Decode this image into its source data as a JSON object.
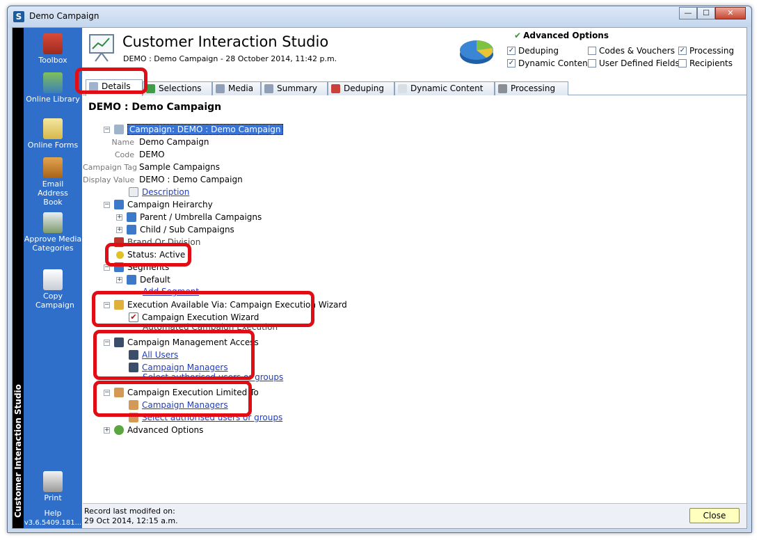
{
  "window": {
    "title": "Demo Campaign",
    "app_icon": "S"
  },
  "sidebar": {
    "vertical_label": "Customer Interaction Studio",
    "version": "v3.6.5409.181..."
  },
  "tools": [
    {
      "icon": "toolbox-icon",
      "label": "Toolbox"
    },
    {
      "icon": "online-library-icon",
      "label": "Online Library"
    },
    {
      "icon": "online-forms-icon",
      "label": "Online Forms"
    },
    {
      "icon": "email-address-book-icon",
      "label": "Email Address Book"
    },
    {
      "icon": "approve-media-icon",
      "label": "Approve Media Categories"
    },
    {
      "icon": "copy-campaign-icon",
      "label": "Copy Campaign"
    },
    {
      "icon": "print-icon",
      "label": "Print"
    },
    {
      "icon": "help-icon",
      "label": "Help"
    }
  ],
  "header": {
    "title": "Customer Interaction Studio",
    "subtitle": "DEMO : Demo Campaign - 28 October 2014, 11:42 p.m.",
    "advanced_options_title": "Advanced Options",
    "options": [
      {
        "label": "Deduping",
        "checked": true
      },
      {
        "label": "Codes & Vouchers",
        "checked": false
      },
      {
        "label": "Processing",
        "checked": true
      },
      {
        "label": "Dynamic Content",
        "checked": true
      },
      {
        "label": "User Defined Fields",
        "checked": false
      },
      {
        "label": "Recipients",
        "checked": false
      }
    ]
  },
  "tabs": [
    "Details",
    "Selections",
    "Media",
    "Summary",
    "Deduping",
    "Dynamic Content",
    "Processing"
  ],
  "content": {
    "title": "DEMO : Demo Campaign",
    "tree": {
      "campaign": "Campaign:  DEMO : Demo Campaign",
      "fields": [
        {
          "label": "Name",
          "value": "Demo Campaign"
        },
        {
          "label": "Code",
          "value": "DEMO"
        },
        {
          "label": "Campaign Tag",
          "value": "Sample Campaigns"
        },
        {
          "label": "Display Value",
          "value": "DEMO : Demo Campaign"
        }
      ],
      "description_link": "Description",
      "hierarchy": "Campaign Heirarchy",
      "parent": "Parent / Umbrella Campaigns",
      "child": "Child / Sub Campaigns",
      "brand": "Brand Or Division",
      "status": "Status:  Active",
      "segments": "Segments",
      "default_segment": "Default",
      "add_segment": "Add Segment",
      "execution": "Execution Available Via:  Campaign Execution Wizard",
      "execution_wizard": "Campaign Execution Wizard",
      "automated": "Automated Campaign Execution",
      "management_access": "Campaign Management Access",
      "all_users": "All Users",
      "campaign_managers": "Campaign Managers",
      "select_management": "Select authorised users or groups",
      "execution_limited": "Campaign Execution Limited To",
      "exec_managers": "Campaign Managers",
      "select_exec": "Select authorised users or groups",
      "advanced": "Advanced Options"
    }
  },
  "footer": {
    "record_label": "Record last modifed on:",
    "record_date": "29 Oct 2014, 12:15 a.m.",
    "close_label": "Close"
  },
  "colors": {
    "accent": "#2f6fc9",
    "highlight": "#e00d14",
    "link": "#1e3cc8"
  }
}
